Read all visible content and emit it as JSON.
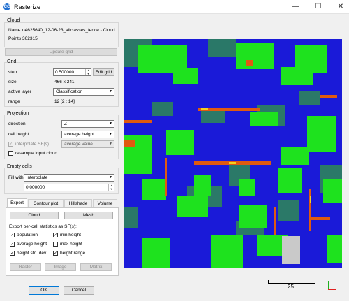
{
  "window": {
    "title": "Rasterize",
    "app_icon_letter": "CC"
  },
  "cloud": {
    "group_title": "Cloud",
    "name_label": "Name",
    "name_value": "u4625640_12-06-23_allclasses_fence - Cloud",
    "points_label": "Points",
    "points_value": "362315",
    "update_button": "Update grid"
  },
  "grid": {
    "group_title": "Grid",
    "step_label": "step",
    "step_value": "0.500000",
    "edit_grid_button": "Edit grid",
    "size_label": "size",
    "size_value": "466 x 241",
    "active_layer_label": "active layer",
    "active_layer_value": "Classification",
    "range_label": "range",
    "range_value": "12 [2 ; 14]"
  },
  "projection": {
    "group_title": "Projection",
    "direction_label": "direction",
    "direction_value": "Z",
    "cell_height_label": "cell height",
    "cell_height_value": "average height",
    "interpolate_label": "interpolate SF(s)",
    "interpolate_value": "average value",
    "resample_label": "resample input cloud"
  },
  "empty_cells": {
    "group_title": "Empty cells",
    "fill_label": "Fill with",
    "fill_value": "interpolate",
    "fill_number": "0.000000"
  },
  "tabs": [
    "Export",
    "Contour plot",
    "Hillshade",
    "Volume"
  ],
  "export": {
    "cloud_button": "Cloud",
    "mesh_button": "Mesh",
    "stats_label": "Export per-cell statistics as SF(s):",
    "checks": {
      "population": "population",
      "min_height": "min height",
      "average_height": "average height",
      "max_height": "max height",
      "height_std_dev": "height std. dev.",
      "height_range": "height range"
    },
    "raster_button": "Raster",
    "image_button": "Image",
    "matrix_button": "Matrix"
  },
  "footer": {
    "ok_button": "OK",
    "cancel_button": "Cancel"
  },
  "map": {
    "scale_value": "25"
  },
  "colors": {
    "ground": "#1a1ad8",
    "buildings": "#1ee21e",
    "vegetation": "#2a8a4a",
    "fence": "#e05a10",
    "accent": "#0078d7"
  }
}
